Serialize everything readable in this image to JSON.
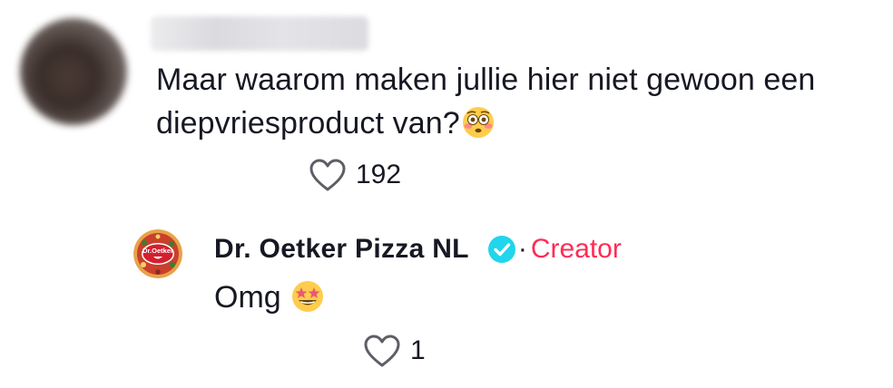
{
  "comment": {
    "author_name": "",
    "text": "Maar waarom maken jullie hier niet gewoon een diepvriesproduct van?",
    "emoji": "flushed-face-emoji",
    "likes": "192"
  },
  "reply": {
    "author_name": "Dr. Oetker Pizza NL",
    "avatar_logo_text": "Dr.Oetker",
    "verified_icon": "verified-check-icon",
    "separator": "·",
    "creator_label": "Creator",
    "text": "Omg",
    "emoji": "star-struck-emoji",
    "likes": "1"
  },
  "colors": {
    "text": "#161823",
    "creator": "#fe2c55",
    "verified": "#20d5ec",
    "heart_stroke": "#5e5e66",
    "brand_red": "#c8102e"
  },
  "icons": {
    "like": "heart-outline-icon"
  }
}
